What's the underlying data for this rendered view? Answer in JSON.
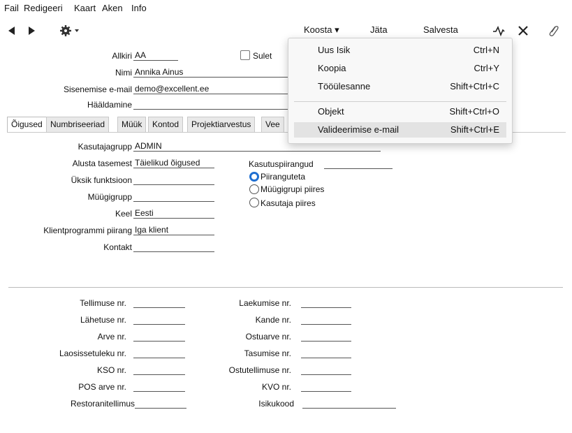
{
  "menubar": {
    "items": [
      "Fail",
      "Redigeeri",
      "Kaart",
      "Aken",
      "Info"
    ]
  },
  "toolbar": {
    "koosta": "Koosta ▾",
    "jata": "Jäta",
    "salvesta": "Salvesta"
  },
  "header_form": {
    "allkiri": {
      "label": "Allkiri",
      "value": "AA"
    },
    "suletud": {
      "label": "Sulet"
    },
    "nimi": {
      "label": "Nimi",
      "value": "Annika Ainus"
    },
    "email": {
      "label": "Sisenemise e-mail",
      "value": "demo@excellent.ee"
    },
    "haaldamine": {
      "label": "Hääldamine",
      "value": ""
    }
  },
  "tabs": [
    "Õigused",
    "Numbriseeriad",
    "Müük",
    "Kontod",
    "Projektiarvestus",
    "Vee"
  ],
  "rights": {
    "kasutajagrupp": {
      "label": "Kasutajagrupp",
      "value": "ADMIN"
    },
    "alusta": {
      "label": "Alusta tasemest",
      "value": "Täielikud õigused"
    },
    "uksik": {
      "label": "Üksik funktsioon",
      "value": ""
    },
    "muugigrupp": {
      "label": "Müügigrupp",
      "value": ""
    },
    "keel": {
      "label": "Keel",
      "value": "Eesti"
    },
    "klient": {
      "label": "Klientprogrammi piirang",
      "value": "Iga klient"
    },
    "kontakt": {
      "label": "Kontakt",
      "value": ""
    },
    "piirangud": {
      "label": "Kasutuspiirangud",
      "value": ""
    },
    "radio": [
      "Piiranguteta",
      "Müügigrupi piires",
      "Kasutaja piires"
    ]
  },
  "numbers_left": [
    {
      "label": "Tellimuse nr.",
      "value": ""
    },
    {
      "label": "Lähetuse nr.",
      "value": ""
    },
    {
      "label": "Arve nr.",
      "value": ""
    },
    {
      "label": "Laosissetuleku nr.",
      "value": ""
    },
    {
      "label": "KSO nr.",
      "value": ""
    },
    {
      "label": "POS arve nr.",
      "value": ""
    },
    {
      "label": "Restoranitellimus",
      "value": ""
    }
  ],
  "numbers_right": [
    {
      "label": "Laekumise nr.",
      "value": ""
    },
    {
      "label": "Kande nr.",
      "value": ""
    },
    {
      "label": "Ostuarve nr.",
      "value": ""
    },
    {
      "label": "Tasumise nr.",
      "value": ""
    },
    {
      "label": "Ostutellimuse nr.",
      "value": ""
    },
    {
      "label": "KVO nr.",
      "value": ""
    },
    {
      "label": "Isikukood",
      "value": ""
    }
  ],
  "dropdown": {
    "items": [
      {
        "label": "Uus Isik",
        "shortcut": "Ctrl+N"
      },
      {
        "label": "Koopia",
        "shortcut": "Ctrl+Y"
      },
      {
        "label": "Tööülesanne",
        "shortcut": "Shift+Ctrl+C"
      },
      {
        "label": "Objekt",
        "shortcut": "Shift+Ctrl+O"
      },
      {
        "label": "Valideerimise e-mail",
        "shortcut": "Shift+Ctrl+E"
      }
    ]
  }
}
